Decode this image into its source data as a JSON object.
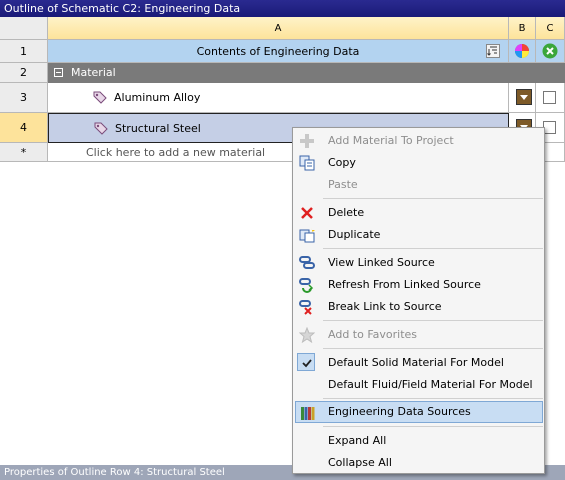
{
  "window": {
    "title": "Outline of Schematic C2: Engineering Data"
  },
  "grid": {
    "columns": [
      "A",
      "B",
      "C"
    ],
    "header_row": {
      "number": "1",
      "label": "Contents of Engineering Data"
    },
    "group_row": {
      "number": "2",
      "label": "Material"
    },
    "rows": [
      {
        "number": "3",
        "label": "Aluminum Alloy"
      },
      {
        "number": "4",
        "label": "Structural Steel"
      }
    ],
    "new_row": {
      "number": "*",
      "label": "Click here to add a new material"
    }
  },
  "properties_bar": {
    "label": "Properties of Outline Row 4: Structural Steel"
  },
  "context_menu": {
    "items": [
      {
        "label": "Add Material To Project",
        "icon": "plus-icon",
        "enabled": false
      },
      {
        "label": "Copy",
        "icon": "copy-icon",
        "enabled": true
      },
      {
        "label": "Paste",
        "icon": "paste-icon",
        "enabled": false
      },
      {
        "label": "Delete",
        "icon": "delete-x-icon",
        "enabled": true
      },
      {
        "label": "Duplicate",
        "icon": "duplicate-icon",
        "enabled": true
      },
      {
        "label": "View Linked Source",
        "icon": "link-view-icon",
        "enabled": true
      },
      {
        "label": "Refresh From Linked Source",
        "icon": "link-refresh-icon",
        "enabled": true
      },
      {
        "label": "Break Link to Source",
        "icon": "link-break-icon",
        "enabled": true
      },
      {
        "label": "Add to Favorites",
        "icon": "star-icon",
        "enabled": false
      },
      {
        "label": "Default Solid Material For Model",
        "icon": "checkmark-icon",
        "enabled": true,
        "checked": true
      },
      {
        "label": "Default Fluid/Field Material For Model",
        "icon": "",
        "enabled": true
      },
      {
        "label": "Engineering Data Sources",
        "icon": "books-icon",
        "enabled": true,
        "highlighted": true
      },
      {
        "label": "Expand All",
        "icon": "",
        "enabled": true
      },
      {
        "label": "Collapse All",
        "icon": "",
        "enabled": true
      }
    ]
  },
  "colors": {
    "title_bar": "#1a1a78",
    "header_highlight": "#fde39b",
    "row1_blue": "#b3d3f0",
    "selected_row": "#c5cfe6",
    "menu_highlight": "#c8ddf3"
  }
}
